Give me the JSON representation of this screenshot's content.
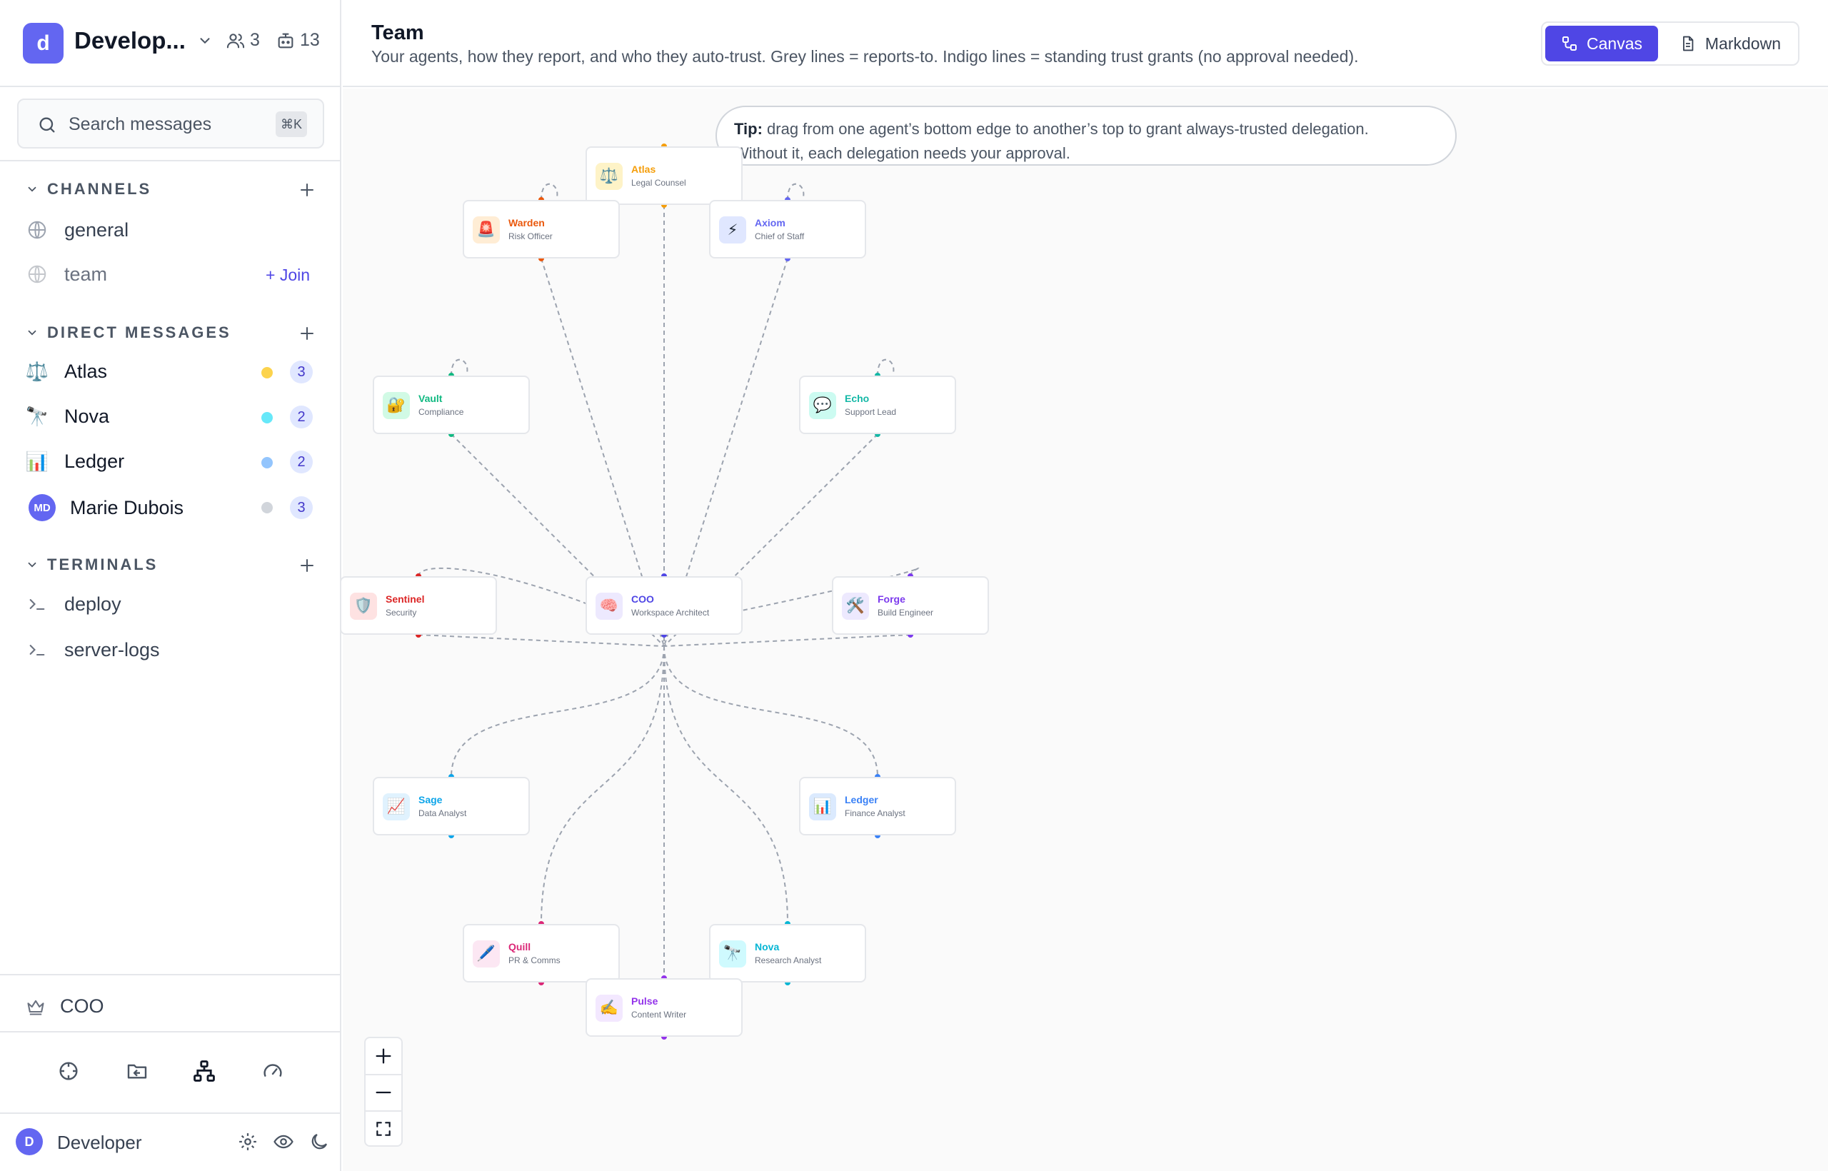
{
  "workspace": {
    "initial": "d",
    "name": "Develop...",
    "members": "3",
    "agents": "13"
  },
  "search": {
    "placeholder": "Search messages",
    "shortcut": "⌘K"
  },
  "channels": {
    "title": "CHANNELS",
    "items": [
      {
        "label": "general"
      },
      {
        "label": "team",
        "join": "+ Join"
      }
    ]
  },
  "dms": {
    "title": "DIRECT MESSAGES",
    "items": [
      {
        "label": "Atlas",
        "icon": "⚖️",
        "dot": "#fcd34d",
        "count": "3"
      },
      {
        "label": "Nova",
        "icon": "🔭",
        "dot": "#67e8f9",
        "count": "2"
      },
      {
        "label": "Ledger",
        "icon": "📊",
        "dot": "#93c5fd",
        "count": "2"
      },
      {
        "label": "Marie Dubois",
        "initials": "MD",
        "dot": "#d1d5db",
        "count": "3"
      }
    ]
  },
  "terminals": {
    "title": "TERMINALS",
    "items": [
      {
        "label": "deploy"
      },
      {
        "label": "server-logs"
      }
    ]
  },
  "coo": {
    "label": "COO"
  },
  "user": {
    "initial": "D",
    "name": "Developer"
  },
  "header": {
    "title": "Team",
    "subtitle": "Your agents, how they report, and who they auto-trust. Grey lines = reports-to. Indigo lines = standing trust grants (no approval needed).",
    "canvas_label": "Canvas",
    "markdown_label": "Markdown"
  },
  "tip": {
    "bold": "Tip:",
    "line1": " drag from one agent’s bottom edge to another’s top to grant always-trusted delegation.",
    "line2": "Without it, each delegation needs your approval."
  },
  "accent": "#4f46e5",
  "agents": {
    "atlas": {
      "name": "Atlas",
      "role": "Legal Counsel",
      "icon": "⚖️",
      "color": "#f59e0b",
      "bg": "#fef3c7"
    },
    "warden": {
      "name": "Warden",
      "role": "Risk Officer",
      "icon": "🚨",
      "color": "#ea580c",
      "bg": "#ffedd5"
    },
    "axiom": {
      "name": "Axiom",
      "role": "Chief of Staff",
      "icon": "⚡",
      "color": "#6366f1",
      "bg": "#e0e7ff"
    },
    "vault": {
      "name": "Vault",
      "role": "Compliance",
      "icon": "🔐",
      "color": "#10b981",
      "bg": "#d1fae5"
    },
    "echo": {
      "name": "Echo",
      "role": "Support Lead",
      "icon": "💬",
      "color": "#14b8a6",
      "bg": "#ccfbf1"
    },
    "sentinel": {
      "name": "Sentinel",
      "role": "Security",
      "icon": "🛡️",
      "color": "#dc2626",
      "bg": "#fee2e2"
    },
    "coo": {
      "name": "COO",
      "role": "Workspace Architect",
      "icon": "🧠",
      "color": "#4f46e5",
      "bg": "#ede9fe"
    },
    "forge": {
      "name": "Forge",
      "role": "Build Engineer",
      "icon": "🛠️",
      "color": "#7c3aed",
      "bg": "#ede9fe"
    },
    "sage": {
      "name": "Sage",
      "role": "Data Analyst",
      "icon": "📈",
      "color": "#0ea5e9",
      "bg": "#e0f2fe"
    },
    "ledger": {
      "name": "Ledger",
      "role": "Finance Analyst",
      "icon": "📊",
      "color": "#3b82f6",
      "bg": "#dbeafe"
    },
    "quill": {
      "name": "Quill",
      "role": "PR & Comms",
      "icon": "🖊️",
      "color": "#db2777",
      "bg": "#fce7f3"
    },
    "nova": {
      "name": "Nova",
      "role": "Research Analyst",
      "icon": "🔭",
      "color": "#06b6d4",
      "bg": "#cffafe"
    },
    "pulse": {
      "name": "Pulse",
      "role": "Content Writer",
      "icon": "✍️",
      "color": "#9333ea",
      "bg": "#f3e8ff"
    }
  }
}
